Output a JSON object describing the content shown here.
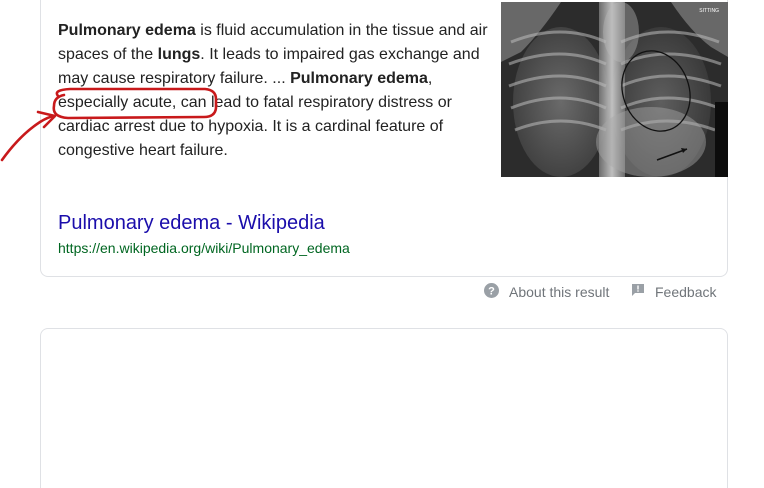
{
  "snippet": {
    "part1": "Pulmonary edema",
    "part2": " is fluid accumulation in the tissue and air spaces of the ",
    "part3": "lungs",
    "part4": ". It leads to impaired gas exchange and may cause respiratory failure. ... ",
    "part5": "Pulmonary edema",
    "part6": ", especially acute, can lead to fatal respiratory distress or cardiac arrest due to hypoxia. It is a cardinal feature of congestive heart failure."
  },
  "image": {
    "label": "SITTING"
  },
  "result": {
    "title": "Pulmonary edema - Wikipedia",
    "url": "https://en.wikipedia.org/wiki/Pulmonary_edema"
  },
  "footer": {
    "about": "About this result",
    "about_icon": "help-circle-icon",
    "feedback": "Feedback",
    "feedback_icon": "feedback-flag-icon"
  },
  "colors": {
    "link": "#1a0dab",
    "url": "#006621",
    "annotation": "#c8191b"
  }
}
